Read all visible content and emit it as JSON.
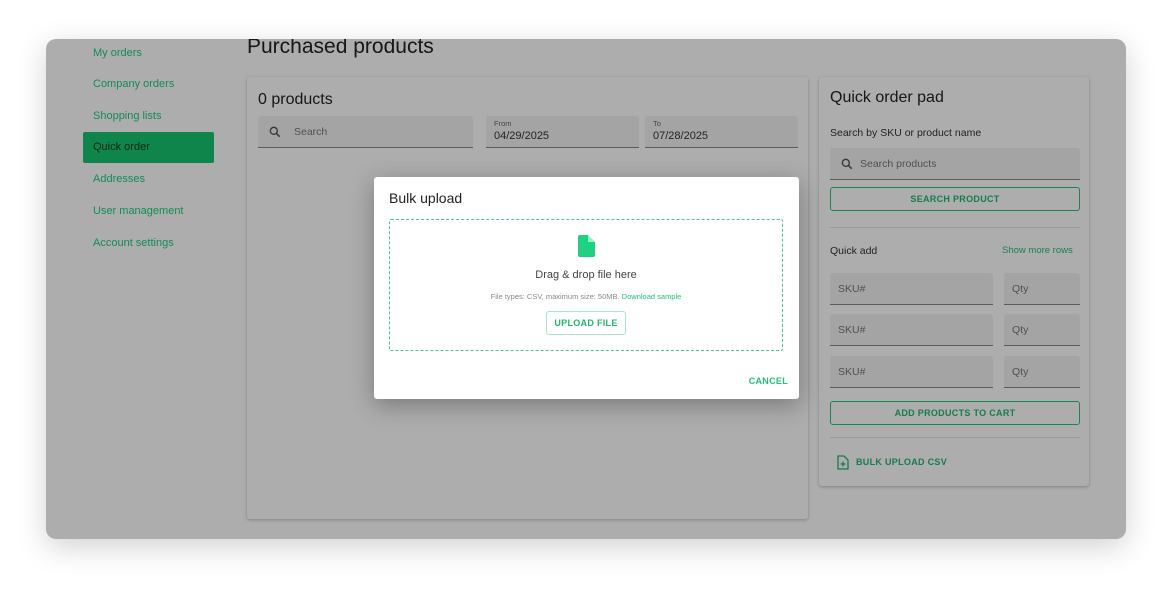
{
  "sidebar": {
    "items": [
      {
        "label": "My orders",
        "active": false
      },
      {
        "label": "Company orders",
        "active": false
      },
      {
        "label": "Shopping lists",
        "active": false
      },
      {
        "label": "Quick order",
        "active": true
      },
      {
        "label": "Addresses",
        "active": false
      },
      {
        "label": "User management",
        "active": false
      },
      {
        "label": "Account settings",
        "active": false
      }
    ]
  },
  "page": {
    "title": "Purchased products"
  },
  "products": {
    "count_label": "0 products",
    "search_placeholder": "Search",
    "from_label": "From",
    "from_value": "04/29/2025",
    "to_label": "To",
    "to_value": "07/28/2025"
  },
  "quick_order": {
    "title": "Quick order pad",
    "search_label": "Search by SKU or product name",
    "search_placeholder": "Search products",
    "search_button": "SEARCH PRODUCT",
    "quick_add_label": "Quick add",
    "show_more": "Show more rows",
    "rows": [
      {
        "sku": "SKU#",
        "qty": "Qty"
      },
      {
        "sku": "SKU#",
        "qty": "Qty"
      },
      {
        "sku": "SKU#",
        "qty": "Qty"
      }
    ],
    "add_button": "ADD PRODUCTS TO CART",
    "bulk_upload": "BULK UPLOAD CSV"
  },
  "modal": {
    "title": "Bulk upload",
    "drop_text": "Drag & drop file here",
    "file_info": "File types: CSV, maximum size: 50MB.",
    "download_sample": "Download sample",
    "upload_button": "UPLOAD FILE",
    "cancel": "CANCEL"
  },
  "colors": {
    "accent": "#18c46f",
    "link": "#20c377"
  },
  "icons": [
    "search-icon",
    "file-icon",
    "upload-csv-icon"
  ]
}
